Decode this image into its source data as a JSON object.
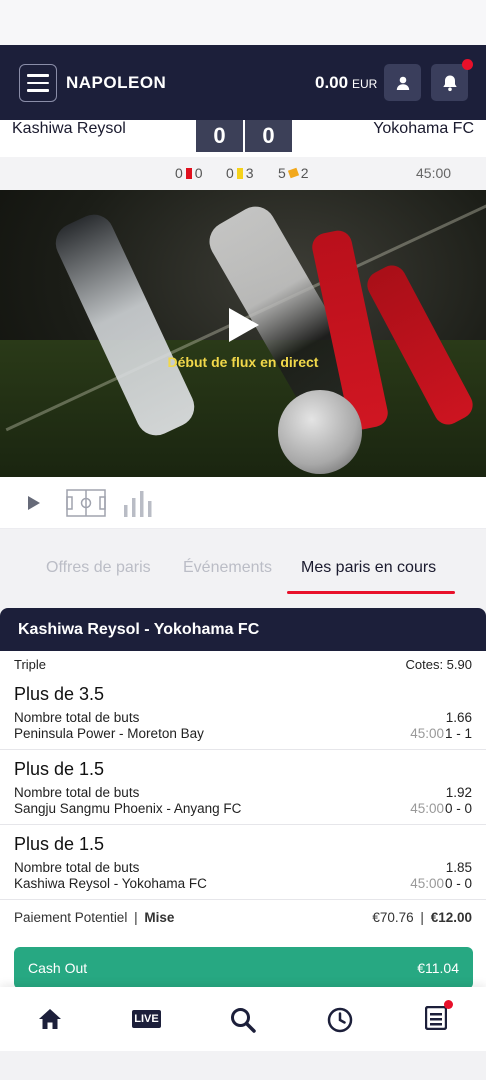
{
  "header": {
    "brand": "NAPOLEON",
    "balance": "0.00",
    "currency": "EUR"
  },
  "match": {
    "home_team": "Kashiwa Reysol",
    "away_team": "Yokohama FC",
    "home_score": "0",
    "away_score": "0",
    "stats": {
      "red_home": "0",
      "red_away": "0",
      "yellow_home": "0",
      "yellow_away": "3",
      "corners_home": "5",
      "corners_away": "2",
      "time": "45:00"
    }
  },
  "video": {
    "status_text": "Début de flux en direct"
  },
  "tabs": [
    {
      "label": "Offres de paris",
      "active": false
    },
    {
      "label": "Événements",
      "active": false
    },
    {
      "label": "Mes paris en cours",
      "active": true
    }
  ],
  "bet": {
    "title": "Kashiwa Reysol - Yokohama FC",
    "type": "Triple",
    "odds_label": "Cotes: 5.90",
    "selections": [
      {
        "name": "Plus de 3.5",
        "market": "Nombre total de buts",
        "match": "Peninsula Power - Moreton Bay",
        "odd": "1.66",
        "time": "45:00",
        "score": "1 - 1"
      },
      {
        "name": "Plus de 1.5",
        "market": "Nombre total de buts",
        "match": "Sangju Sangmu Phoenix - Anyang FC",
        "odd": "1.92",
        "time": "45:00",
        "score": "0 - 0"
      },
      {
        "name": "Plus de 1.5",
        "market": "Nombre total de buts",
        "match": "Kashiwa Reysol - Yokohama FC",
        "odd": "1.85",
        "time": "45:00",
        "score": "0 - 0"
      }
    ],
    "payout_label": "Paiement Potentiel",
    "separator": "|",
    "stake_label": "Mise",
    "payout_value": "€70.76",
    "stake_value": "€12.00",
    "cashout_label": "Cash Out",
    "cashout_value": "€11.04"
  },
  "nav": {
    "live_label": "LIVE"
  },
  "colors": {
    "header_bg": "#1c1f3a",
    "accent_red": "#e8102a",
    "cashout_green": "#27a882",
    "live_text": "#f1d84a"
  }
}
